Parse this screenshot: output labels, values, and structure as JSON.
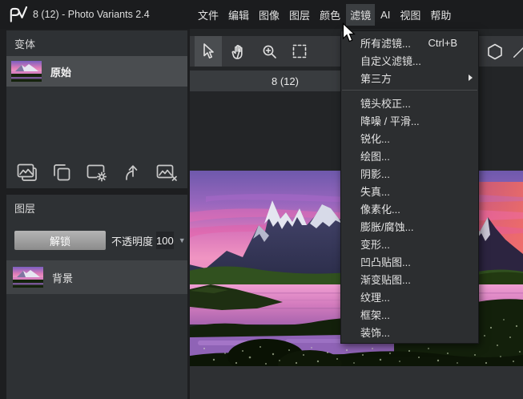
{
  "window": {
    "logo": "PV",
    "title": "8 (12) - Photo Variants 2.4"
  },
  "menubar": {
    "items": [
      {
        "label": "文件"
      },
      {
        "label": "编辑"
      },
      {
        "label": "图像"
      },
      {
        "label": "图层"
      },
      {
        "label": "颜色"
      },
      {
        "label": "滤镜",
        "active": true
      },
      {
        "label": "AI"
      },
      {
        "label": "视图"
      },
      {
        "label": "帮助"
      }
    ]
  },
  "filter_menu": {
    "items": [
      {
        "label": "所有滤镜...",
        "shortcut": "Ctrl+B"
      },
      {
        "label": "自定义滤镜..."
      },
      {
        "label": "第三方",
        "submenu": true
      },
      {
        "separator": true
      },
      {
        "label": "镜头校正..."
      },
      {
        "label": "降噪 / 平滑..."
      },
      {
        "label": "锐化..."
      },
      {
        "label": "绘图..."
      },
      {
        "label": "阴影..."
      },
      {
        "label": "失真..."
      },
      {
        "label": "像素化..."
      },
      {
        "label": "膨胀/腐蚀..."
      },
      {
        "label": "变形..."
      },
      {
        "label": "凹凸贴图..."
      },
      {
        "label": "渐变贴图..."
      },
      {
        "label": "纹理..."
      },
      {
        "label": "框架..."
      },
      {
        "label": "装饰..."
      }
    ]
  },
  "variants_panel": {
    "title": "变体",
    "items": [
      {
        "label": "原始",
        "selected": true
      }
    ]
  },
  "layers_panel": {
    "title": "图层",
    "unlock_button": "解锁",
    "opacity_label": "不透明度",
    "opacity_value": "100",
    "layers": [
      {
        "label": "背景"
      }
    ]
  },
  "canvas": {
    "tab_label": "8 (12)"
  },
  "icons": {
    "app-logo": "PV-monogram",
    "pointer-tool-icon": "cursor-arrow",
    "hand-tool-icon": "open-hand",
    "zoom-tool-icon": "magnifier-plus",
    "marquee-tool-icon": "dashed-rectangle",
    "polygon-tool-icon": "hexagon-outline",
    "line-tool-icon": "diagonal-line",
    "add-variant-icon": "stacked-images",
    "duplicate-variant-icon": "overlapping-squares",
    "variant-settings-icon": "frame-with-gear",
    "export-variant-icon": "curved-up-arrow",
    "delete-variant-icon": "image-with-x",
    "opacity-caret-icon": "triangle-down",
    "submenu-arrow-icon": "triangle-right",
    "mouse-cursor": "arrow-pointer"
  },
  "colors": {
    "window_bg": "#1d1e20",
    "topbar_bg": "#1b1c1e",
    "panel_bg": "#2e3134",
    "selected_item_bg": "#4a4d50",
    "menu_highlight_bg": "#3b3e41",
    "dropdown_bg": "#2c2e30",
    "toolbar_bg": "#36383b",
    "tab_bg": "#393c3f",
    "canvas_bg": "#232527",
    "unlock_button_top": "#b4b4b4",
    "unlock_button_bottom": "#8c8c8c",
    "text_primary": "#e4e4e4"
  }
}
